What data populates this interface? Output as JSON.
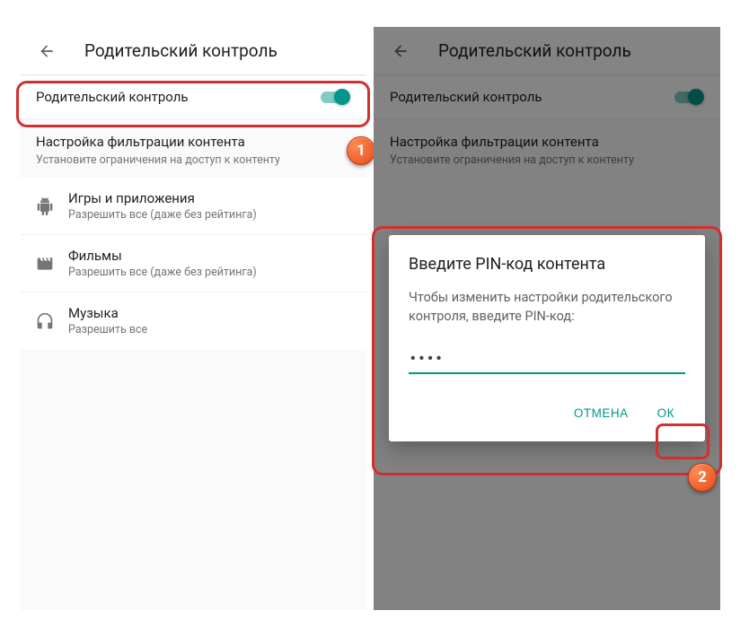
{
  "header": {
    "title": "Родительский контроль"
  },
  "toggle": {
    "label": "Родительский контроль"
  },
  "section": {
    "title": "Настройка фильтрации контента",
    "sub": "Установите ограничения на доступ к контенту"
  },
  "items": [
    {
      "title": "Игры и приложения",
      "sub": "Разрешить все (даже без рейтинга)"
    },
    {
      "title": "Фильмы",
      "sub": "Разрешить все (даже без рейтинга)"
    },
    {
      "title": "Музыка",
      "sub": "Разрешить все"
    }
  ],
  "dialog": {
    "title": "Введите PIN-код контента",
    "message": "Чтобы изменить настройки родительского контроля, введите PIN-код:",
    "pin_value": "••••",
    "cancel": "ОТМЕНА",
    "ok": "ОК"
  },
  "badges": {
    "one": "1",
    "two": "2"
  }
}
